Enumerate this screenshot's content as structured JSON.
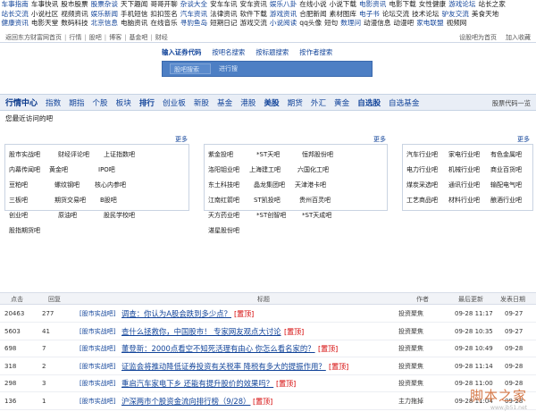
{
  "top_links": [
    [
      "车事指南",
      "车事快讯",
      "股市股票",
      "股票杂谈",
      "天下趣闻",
      "哥哥开聊",
      "杂谈大全",
      "安车车讯",
      "安车资讯",
      "娱乐八卦",
      "在线小说",
      "小说下载",
      "电影资讯",
      "电影下载",
      "女性健康",
      "游戏论坛",
      "站长之家"
    ],
    [
      "站长交流",
      "小说社区",
      "视频资讯",
      "娱乐新闻",
      "手机短信",
      "扣扣签名",
      "汽车资讯",
      "法律资讯",
      "软件下载",
      "游戏资讯",
      "合肥新闻",
      "素材图库",
      "电子书",
      "论坛交流",
      "技术论坛",
      "驴友交流",
      "美食天地"
    ],
    [
      "健康资讯",
      "电影天堂",
      "数码科技",
      "北京信息",
      "电脑资讯",
      "在线音乐",
      "寻豹鱼岛",
      "短期日记",
      "游戏交流",
      "小说阅读",
      "qq头像",
      "短句",
      "数理问",
      "动漫信息",
      "动漫吧",
      "家电联盟",
      "视频网"
    ]
  ],
  "site_bar": {
    "left": [
      "返回东方财富网首页",
      "行情",
      "股吧",
      "博客",
      "基金吧",
      "财经"
    ],
    "right": [
      "设股吧为首页",
      "加入收藏"
    ]
  },
  "search": {
    "tabs": [
      "输入证券代码",
      "按吧名搜索",
      "按标题搜索",
      "按作者搜索"
    ],
    "input_placeholder": "股吧搜索",
    "button_label": "进行搜"
  },
  "nav": {
    "home": "行情中心",
    "items": [
      "指数",
      "期指",
      "个股",
      "板块",
      "排行",
      "创业板",
      "新股",
      "基金",
      "港股",
      "美股",
      "期货",
      "外汇",
      "黄金",
      "自选股",
      "自选基金"
    ],
    "bold_items": [
      "排行",
      "美股",
      "自选股"
    ],
    "right_label": "股票代码一览"
  },
  "recent_label": "您最近访问的吧",
  "more_label": "更多",
  "categories": [
    [
      "股市实战吧",
      "财经评论吧",
      "上证指数吧",
      "内幕传闻吧",
      "黄金吧",
      "IPO吧",
      "豆粕吧",
      "螺纹钢吧",
      "核心内参吧",
      "三板吧",
      "期货交易吧",
      "B股吧",
      "创业吧",
      "原油吧",
      "股民学校吧",
      "股指期货吧"
    ],
    [
      "紫金投吧",
      "*ST天吧",
      "恒邦股份吧",
      "洛阳钼业吧",
      "上海建工吧",
      "六国化工吧",
      "东土科技吧",
      "晶龙集团吧",
      "天津港卡吧",
      "江南红箭吧",
      "ST凯投吧",
      "贵州百灵吧",
      "天方药业吧",
      "*ST创智吧",
      "*ST天成吧",
      "湛星股份吧"
    ],
    [
      "汽车行业吧",
      "家电行业吧",
      "有色金属吧",
      "电力行业吧",
      "机械行业吧",
      "商业百货吧",
      "煤炭采选吧",
      "通讯行业吧",
      "输配电气吧",
      "工艺商品吧",
      "材料行业吧",
      "酿酒行业吧"
    ]
  ],
  "table": {
    "headers": {
      "clicks": "点击",
      "replies": "回复",
      "title": "标题",
      "author": "作者",
      "updated": "最后更新",
      "posted": "发表日期"
    },
    "rows": [
      {
        "clicks": "20463",
        "replies": "277",
        "board": "[股市实战吧]",
        "title": "调查：你认为A股会跌到多少点？",
        "tag": "[置顶]",
        "author": "投资聚焦",
        "updated": "09-28 11:17",
        "posted": "09-27"
      },
      {
        "clicks": "5603",
        "replies": "41",
        "board": "[股市实战吧]",
        "title": "查什么拯救你，中国股市！ 专家网友观点大讨论",
        "tag": "[置顶]",
        "author": "投资聚焦",
        "updated": "09-28 10:35",
        "posted": "09-27"
      },
      {
        "clicks": "698",
        "replies": "7",
        "board": "[股市实战吧]",
        "title": "董登新：2000点看空不知死活理有由心 你怎么看名家的？",
        "tag": "[置顶]",
        "author": "投资聚焦",
        "updated": "09-28 10:49",
        "posted": "09-28"
      },
      {
        "clicks": "318",
        "replies": "2",
        "board": "[股市实战吧]",
        "title": "证监会将推动降低证券投资有关税率 降税有多大的提振作用？",
        "tag": "[置顶]",
        "author": "投资聚焦",
        "updated": "09-28 11:14",
        "posted": "09-28"
      },
      {
        "clicks": "298",
        "replies": "3",
        "board": "[股市实战吧]",
        "title": "重启汽车家电下乡 还能有提升股价的效果吗？",
        "tag": "[置顶]",
        "author": "投资聚焦",
        "updated": "09-28 11:00",
        "posted": "09-28"
      },
      {
        "clicks": "136",
        "replies": "1",
        "board": "[股市实战吧]",
        "title": "沪深两市个股资金流向排行榜（9/28）",
        "tag": "[置顶]",
        "author": "主力拖掉",
        "updated": "09-28 11:04",
        "posted": "09-28"
      }
    ]
  },
  "watermark": {
    "line1": "脚本之家",
    "line2": "www.jb51.net"
  }
}
